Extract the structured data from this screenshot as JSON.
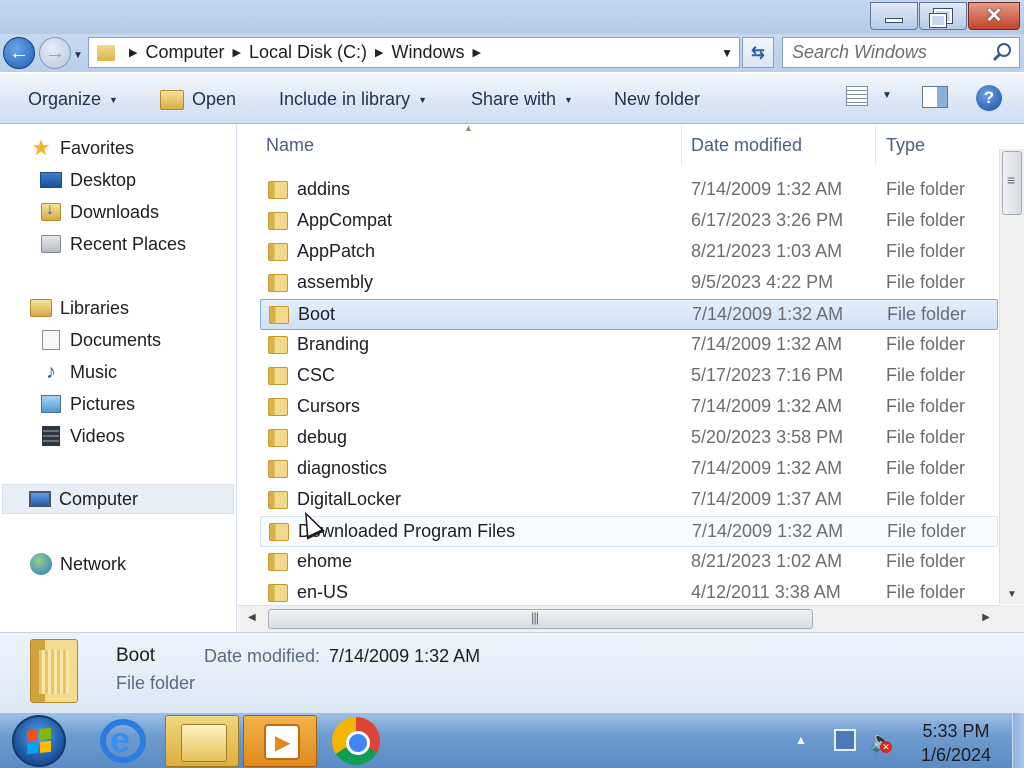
{
  "window": {
    "minimize_icon": "minimize-icon",
    "restore_icon": "restore-icon",
    "close_icon": "close-icon"
  },
  "address": {
    "crumbs": [
      "Computer",
      "Local Disk (C:)",
      "Windows"
    ],
    "search_placeholder": "Search Windows"
  },
  "toolbar": {
    "organize": "Organize",
    "open": "Open",
    "include": "Include in library",
    "share": "Share with",
    "new_folder": "New folder"
  },
  "nav": {
    "favorites": "Favorites",
    "desktop": "Desktop",
    "downloads": "Downloads",
    "recent": "Recent Places",
    "libraries": "Libraries",
    "documents": "Documents",
    "music": "Music",
    "pictures": "Pictures",
    "videos": "Videos",
    "computer": "Computer",
    "network": "Network"
  },
  "columns": {
    "name": "Name",
    "date": "Date modified",
    "type": "Type"
  },
  "files": [
    {
      "name": "addins",
      "date": "7/14/2009 1:32 AM",
      "type": "File folder"
    },
    {
      "name": "AppCompat",
      "date": "6/17/2023 3:26 PM",
      "type": "File folder"
    },
    {
      "name": "AppPatch",
      "date": "8/21/2023 1:03 AM",
      "type": "File folder"
    },
    {
      "name": "assembly",
      "date": "9/5/2023 4:22 PM",
      "type": "File folder"
    },
    {
      "name": "Boot",
      "date": "7/14/2009 1:32 AM",
      "type": "File folder"
    },
    {
      "name": "Branding",
      "date": "7/14/2009 1:32 AM",
      "type": "File folder"
    },
    {
      "name": "CSC",
      "date": "5/17/2023 7:16 PM",
      "type": "File folder"
    },
    {
      "name": "Cursors",
      "date": "7/14/2009 1:32 AM",
      "type": "File folder"
    },
    {
      "name": "debug",
      "date": "5/20/2023 3:58 PM",
      "type": "File folder"
    },
    {
      "name": "diagnostics",
      "date": "7/14/2009 1:32 AM",
      "type": "File folder"
    },
    {
      "name": "DigitalLocker",
      "date": "7/14/2009 1:37 AM",
      "type": "File folder"
    },
    {
      "name": "Downloaded Program Files",
      "date": "7/14/2009 1:32 AM",
      "type": "File folder"
    },
    {
      "name": "ehome",
      "date": "8/21/2023 1:02 AM",
      "type": "File folder"
    },
    {
      "name": "en-US",
      "date": "4/12/2011 3:38 AM",
      "type": "File folder"
    }
  ],
  "selected_index": 4,
  "hover_index": 11,
  "details": {
    "name": "Boot",
    "date_label": "Date modified:",
    "date_value": "7/14/2009 1:32 AM",
    "type": "File folder"
  },
  "taskbar": {
    "time": "5:33 PM",
    "date": "1/6/2024"
  }
}
